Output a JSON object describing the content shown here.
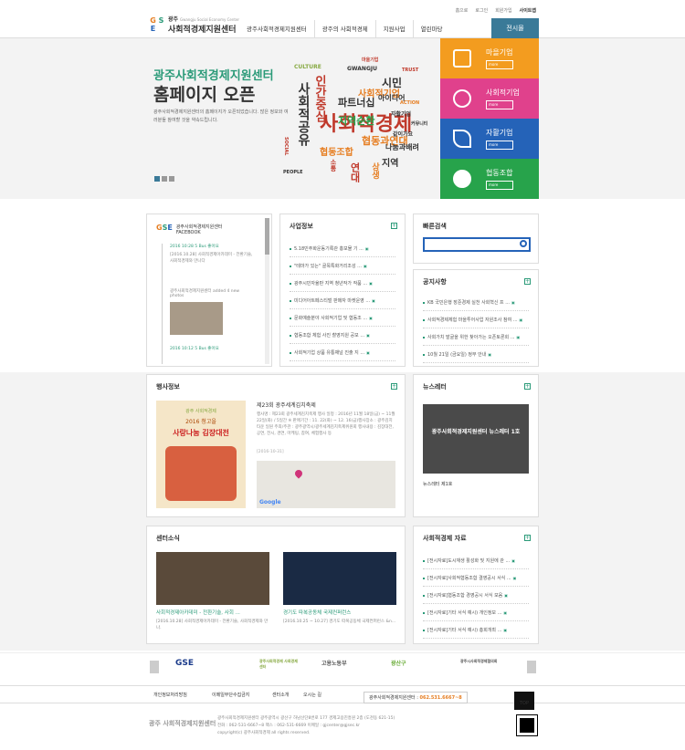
{
  "util": [
    "홈으로",
    "로그인",
    "회원가입",
    "사이트맵"
  ],
  "logo": {
    "mark": "GSE",
    "t1": "광주",
    "t2": "Gwangju Social Economy Center",
    "t3": "사회적경제지원센터"
  },
  "gnb": [
    "광주사회적경제지원센터",
    "광주의 사회적경제",
    "지원사업",
    "열린마당"
  ],
  "mall": "전시몰",
  "hero": {
    "h1": "광주사회적경제지원센터",
    "h2": "홈페이지 오픈",
    "desc": "광주사회적경제지원센터의 홈페이지가 오픈되었습니다. 많은 정보와 여러분들 참여할 것을 약속드립니다.",
    "cloud": [
      "사회적경제",
      "사회적공유",
      "파트너십",
      "지역순환",
      "협동과연대",
      "사회적기업",
      "시민",
      "아이디어",
      "지역",
      "협동조합",
      "인간중심",
      "CULTURE",
      "GWANGJU",
      "TRUST",
      "SOCIAL",
      "PEOPLE",
      "마을기업",
      "나눔과배려",
      "같이가요",
      "자활기업",
      "ACTION",
      "연대",
      "상생",
      "소통",
      "커뮤니티"
    ]
  },
  "cats": [
    {
      "name": "마을기업",
      "more": "more",
      "color": "#f39c1f"
    },
    {
      "name": "사회적기업",
      "more": "more",
      "color": "#e0418c"
    },
    {
      "name": "자활기업",
      "more": "more",
      "color": "#2563b8"
    },
    {
      "name": "협동조합",
      "more": "more",
      "color": "#27a34b"
    }
  ],
  "facebook": {
    "title": "광주사회적경제지원센터 FACEBOOK",
    "date": "2016 10:28",
    "like": "5 Bus 좋아요",
    "text": "[2016.10.28] 사회적경제아카데미 - 전환기술, 사회적경제와 만나다",
    "added": "광주사회적경제지원센터 added 4 new photos",
    "date2": "2016 10:12",
    "like2": "5 Bus 좋아요"
  },
  "business": {
    "title": "사업정보",
    "items": [
      "5.18민주화운동기록관 홍보물 기 ...",
      "\"테마가 있는\" 골목특화거리조성 ...",
      "광주시민자율판 지역 청년작가 작품 ...",
      "미디어아트페스티벌 판매자 마켓운영 ...",
      "문화예술분야 사회적기업 및 협동조 ...",
      "협동조합 체험 사진 촬영지원 공모 ...",
      "사회적기업 상품 유통채널 진출 지 ..."
    ]
  },
  "search": {
    "title": "빠른검색"
  },
  "notice": {
    "title": "공지사항",
    "items": [
      "KB 국민은행 장준경제 실천 사회혁신 프 ...",
      "사회적경제체험 마을투어사업 자원조사 참여 ...",
      "사회가치 발굴을 위한 찾아가는 오픈토론회 ...",
      "10월 21일 (금요일) 정무 안내"
    ]
  },
  "event": {
    "title": "행사정보",
    "poster": [
      "광주 사회적경제",
      "2016 청고을",
      "사랑나눔 김장대전"
    ],
    "head": "제23회 광주세계김치축제",
    "body": "행사명 : 제23회 광주세계김치축제 행사 일정 : 2016년 11월 18일(금) ~ 11월 22일(화) / 5일간 ※ 판매기간 : 11. 22(화) ~ 12. 16(금)행사장소 : 광주김치타운 일원 주최/주관 : 광주광역시/광주세계김치축제위원회 행사내용 : 김장대전, 공연, 전시, 경연, 마케팅, 참여, 체험행사 등",
    "date": "[2016-10-31]",
    "map_brand": "Google"
  },
  "newsletter": {
    "title": "뉴스레터",
    "img_text": "광주사회적경제지원센터 뉴스레터 1호",
    "caption": "뉴스레터 제1호"
  },
  "center": {
    "title": "센터소식",
    "items": [
      {
        "head": "사회적경제아카데미 - 전환기술, 사회 ...",
        "body": "[2016.10.28] 사회적경제아카데미 - 전환기술, 사회적경제와 만나."
      },
      {
        "head": "경기도 따복공동체 국제컨퍼런스",
        "body": "[2016.10.25 ~ 10.27] 경기도 따복공동체 국제컨퍼런스 &n..."
      }
    ]
  },
  "data": {
    "title": "사회적경제 자료",
    "items": [
      "[전시자료]도시재생 활성화 및 지원에 관 ...",
      "[전시자료]사회적협동조합 결영공시 서식 ...",
      "[전시자료]협동조합 경영공시 서식 모음",
      "[전시자료]기타 서식 예시) 개인정보 ...",
      "[전시자료]기타 서식 예시) 총회개최 ..."
    ]
  },
  "partners": [
    "GSE",
    "광주사회적경제 사회경제센터",
    "고용노동부",
    "광산구",
    "광주시사회적경제협의회"
  ],
  "fnav": [
    "개인정보처리방침",
    "이메일무단수집금지",
    "센터소개",
    "오시는 길"
  ],
  "call": {
    "label": "광주사회적경제지원센터",
    "num": "062.531.6667~8"
  },
  "top": "TOP",
  "footer": {
    "logo": "광주 사회적경제지원센터",
    "addr1": "광주사회적경제지원센터 광주광역시 광산구 하남산단8번로 177 경제고용진흥원 2층 (도천동 621-15)",
    "addr2": "전화 : 062-531-6667~8 팩스 : 062-531-6669 이메일 : gjcenter@gjsec.kr",
    "copy": "copyright(c) 광주사회적경제 all rights reserved."
  }
}
